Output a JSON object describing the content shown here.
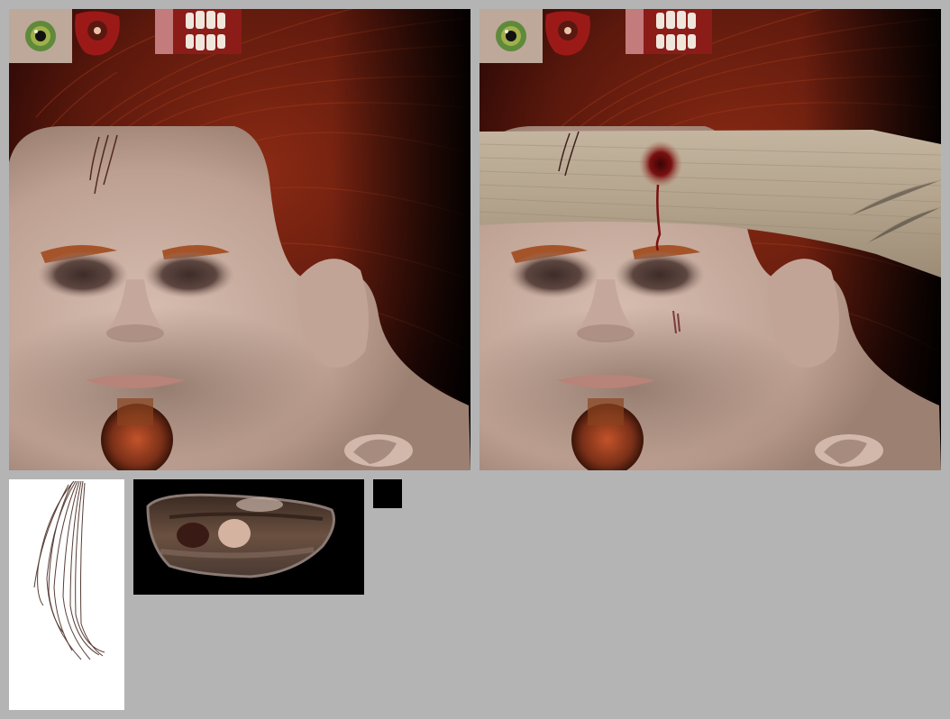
{
  "atlas": {
    "background": "#b4b4b4",
    "tiles": [
      {
        "name": "face-texture-plain",
        "kind": "skin-atlas",
        "variant": "no bandage"
      },
      {
        "name": "face-texture-bandaged",
        "kind": "skin-atlas",
        "variant": "bandage with blood wound"
      },
      {
        "name": "hair-strand-texture",
        "kind": "hair alpha card"
      },
      {
        "name": "eye-shadow-texture",
        "kind": "eye socket overlay"
      },
      {
        "name": "black-swatch-texture",
        "kind": "solid swatch"
      }
    ]
  },
  "colors": {
    "hair": "#6b1e10",
    "hair_dark": "#2a0806",
    "skin": "#c9ada0",
    "skin_shadow": "#8e7466",
    "iris": "#5f8a3a",
    "brow": "#a5542a",
    "goatee": "#8a4320",
    "lips": "#b88378",
    "bandage": "#b5a691",
    "blood": "#7a1010",
    "teeth_gum": "#9b1a18"
  },
  "icons": [
    "eyeball-icon",
    "eyelid-gore-icon",
    "teeth-gums-icon"
  ]
}
